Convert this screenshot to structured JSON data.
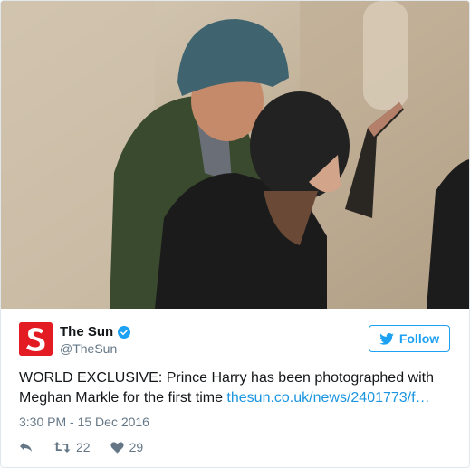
{
  "photo": {
    "alt_icon": "photo"
  },
  "account": {
    "name": "The Sun",
    "handle": "@TheSun",
    "avatar_letter": "S",
    "avatar_color": "#e31b23",
    "verified_icon": "verified-badge-icon"
  },
  "follow_button": {
    "label": "Follow",
    "icon": "twitter-bird-icon",
    "color": "#1da1f2"
  },
  "tweet": {
    "text": "WORLD EXCLUSIVE: Prince Harry has been photographed with Meghan Markle for the first time",
    "link": "thesun.co.uk/news/2401773/f…",
    "link_color": "#1b95e0"
  },
  "timestamp": "3:30 PM - 15 Dec 2016",
  "actions": {
    "reply_icon": "reply-icon",
    "retweet_icon": "retweet-icon",
    "retweet_count": "22",
    "like_icon": "heart-icon",
    "like_count": "29"
  }
}
